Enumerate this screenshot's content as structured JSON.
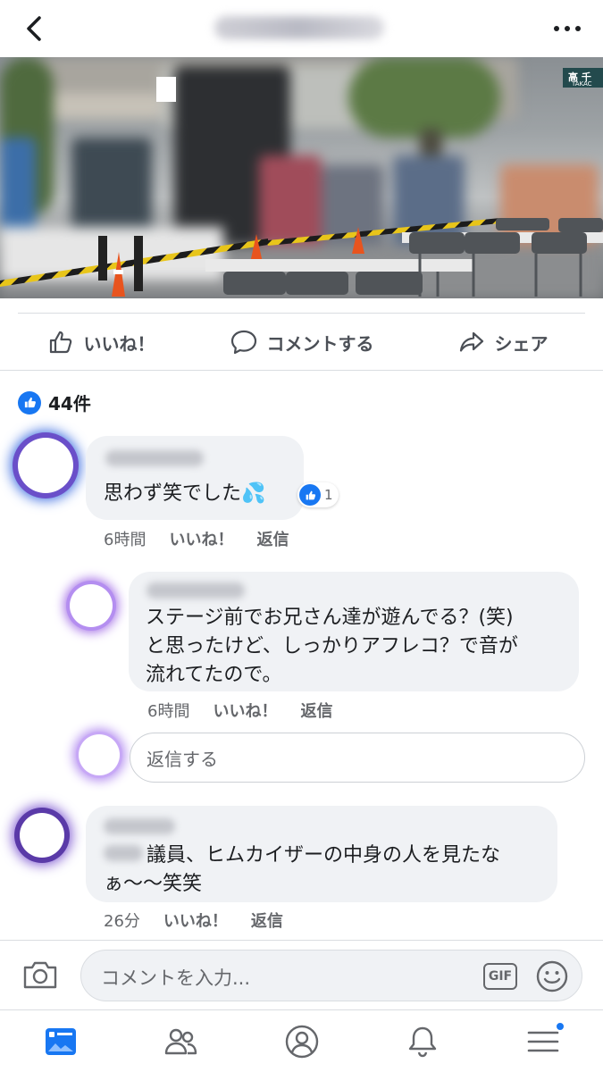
{
  "actions": {
    "like": "いいね！",
    "comment": "コメントする",
    "share": "シェア"
  },
  "likes": {
    "count": "44件"
  },
  "comments": [
    {
      "text": "思わず笑でした💦",
      "reaction_count": "1",
      "time": "6時間",
      "like": "いいね！",
      "reply": "返信"
    },
    {
      "text": "ステージ前でお兄さん達が遊んでる？(笑)\nと思ったけど、しっかりアフレコ？で音が\n流れてたので。",
      "time": "6時間",
      "like": "いいね！",
      "reply": "返信"
    },
    {
      "text": "議員、ヒムカイザーの中身の人を見たな\nぁ〜〜笑笑",
      "time": "26分",
      "like": "いいね！",
      "reply": "返信"
    }
  ],
  "reply_input": {
    "placeholder": "返信する"
  },
  "comment_input": {
    "placeholder": "コメントを入力...",
    "gif": "GIF"
  },
  "photo": {
    "sign_text": "高 千",
    "sign_sub": "TAKAC"
  },
  "colors": {
    "accent": "#1877f2",
    "bubble": "#f0f2f5",
    "secondary_text": "#65676b"
  },
  "tabs": [
    "news-feed-icon",
    "friends-icon",
    "profile-icon",
    "notifications-icon",
    "menu-icon"
  ]
}
